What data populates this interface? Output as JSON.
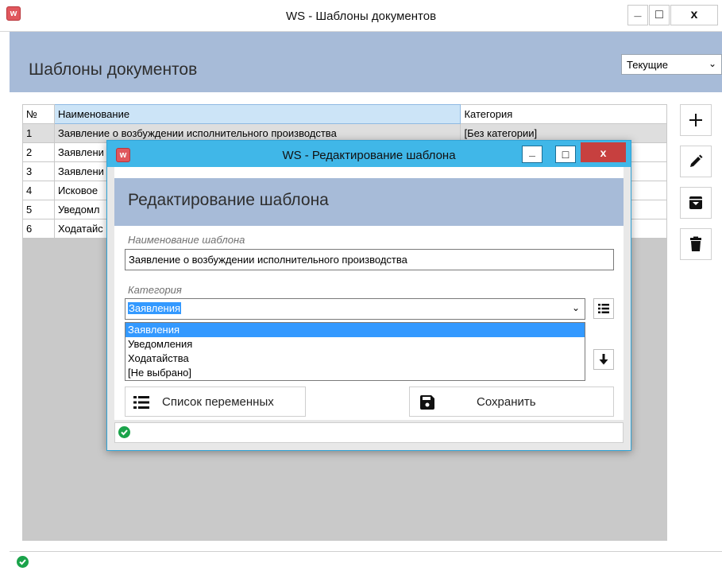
{
  "main_window": {
    "title": "WS - Шаблоны документов",
    "app_icon_letter": "w",
    "heading": "Шаблоны документов",
    "filter": {
      "selected": "Текущие"
    },
    "controls": {
      "minimize": "_",
      "maximize": "□",
      "close": "x"
    }
  },
  "table": {
    "columns": [
      "№",
      "Наименование",
      "Категория"
    ],
    "rows": [
      {
        "num": "1",
        "name": "Заявление о возбуждении исполнительного производства",
        "category": "[Без категории]"
      },
      {
        "num": "2",
        "name": "Заявлени",
        "category": ""
      },
      {
        "num": "3",
        "name": "Заявлени",
        "category": ""
      },
      {
        "num": "4",
        "name": "Исковое",
        "category": ""
      },
      {
        "num": "5",
        "name": "Уведомл",
        "category": ""
      },
      {
        "num": "6",
        "name": "Ходатайс",
        "category": ""
      }
    ]
  },
  "side_toolbar": [
    "plus-icon",
    "pencil-icon",
    "archive-icon",
    "trash-icon"
  ],
  "dialog": {
    "title": "WS - Редактирование шаблона",
    "app_icon_letter": "w",
    "heading": "Редактирование шаблона",
    "controls": {
      "minimize": "_",
      "maximize": "□",
      "close": "x"
    },
    "name_field": {
      "label": "Наименование шаблона",
      "value": "Заявление о возбуждении исполнительного производства"
    },
    "category_field": {
      "label": "Категория",
      "value": "Заявления",
      "options": [
        "Заявления",
        "Уведомления",
        "Ходатайства",
        "[Не выбрано]"
      ]
    },
    "buttons": {
      "variables_label": "Список переменных",
      "save_label": "Сохранить"
    }
  },
  "colors": {
    "header_band": "#a7bbd8",
    "dialog_title_bar": "#40b7e8",
    "dialog_close": "#c7403f",
    "selection": "#3399ff",
    "status_ok": "#1aa34a"
  }
}
